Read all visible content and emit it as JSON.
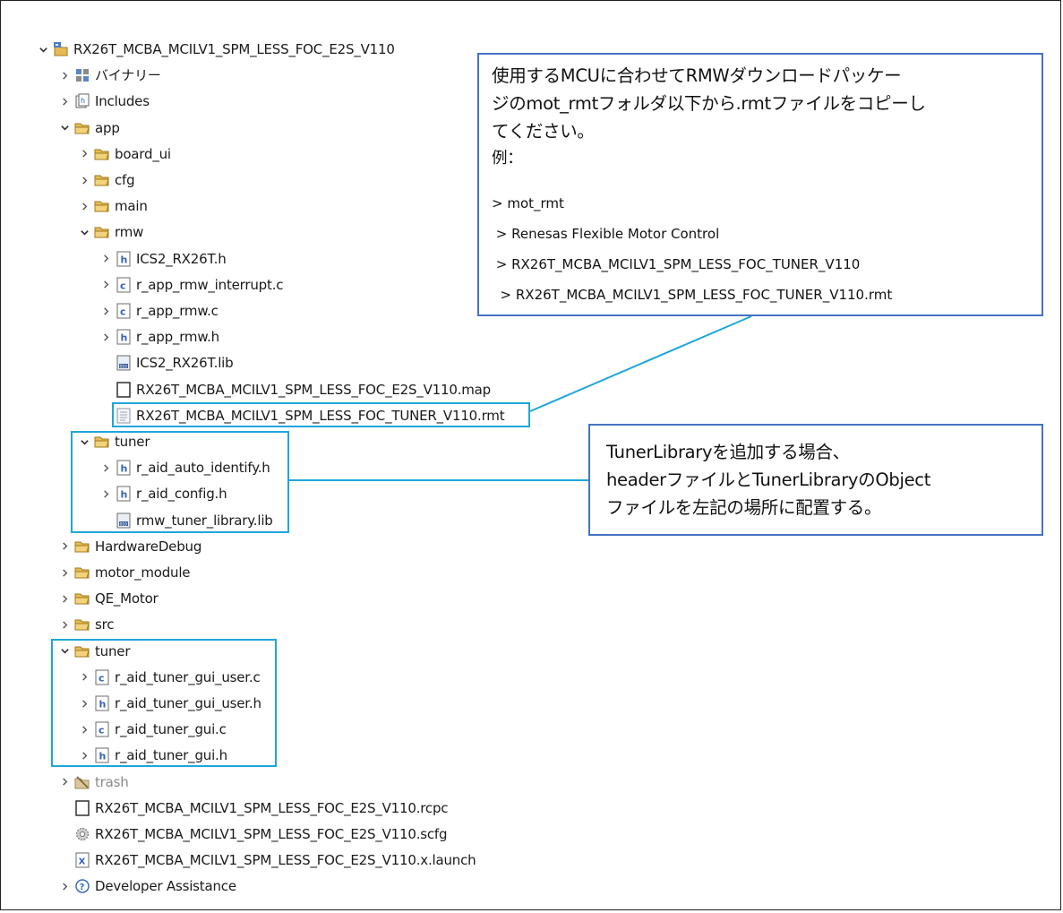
{
  "tree": [
    {
      "label": "RX26T_MCBA_MCILV1_SPM_LESS_FOC_E2S_V110",
      "icon": "project-icon",
      "expand": "expanded",
      "level": 0
    },
    {
      "label": "バイナリー",
      "icon": "binaries-icon",
      "expand": "collapsed",
      "level": 1
    },
    {
      "label": "Includes",
      "icon": "includes-icon",
      "expand": "collapsed",
      "level": 1
    },
    {
      "label": "app",
      "icon": "folder-icon",
      "expand": "expanded",
      "level": 1
    },
    {
      "label": "board_ui",
      "icon": "folder-icon",
      "expand": "collapsed",
      "level": 2
    },
    {
      "label": "cfg",
      "icon": "folder-icon",
      "expand": "collapsed",
      "level": 2
    },
    {
      "label": "main",
      "icon": "folder-icon",
      "expand": "collapsed",
      "level": 2
    },
    {
      "label": "rmw",
      "icon": "folder-icon",
      "expand": "expanded",
      "level": 2
    },
    {
      "label": "ICS2_RX26T.h",
      "icon": "header-file-icon",
      "expand": "collapsed",
      "level": 3
    },
    {
      "label": "r_app_rmw_interrupt.c",
      "icon": "c-file-icon",
      "expand": "collapsed",
      "level": 3
    },
    {
      "label": "r_app_rmw.c",
      "icon": "c-file-icon",
      "expand": "collapsed",
      "level": 3
    },
    {
      "label": "r_app_rmw.h",
      "icon": "header-file-icon",
      "expand": "collapsed",
      "level": 3
    },
    {
      "label": "ICS2_RX26T.lib",
      "icon": "lib-file-icon",
      "expand": "none",
      "level": 3
    },
    {
      "label": "RX26T_MCBA_MCILV1_SPM_LESS_FOC_E2S_V110.map",
      "icon": "blank-file-icon",
      "expand": "none",
      "level": 3
    },
    {
      "label": "RX26T_MCBA_MCILV1_SPM_LESS_FOC_TUNER_V110.rmt",
      "icon": "text-file-icon",
      "expand": "none",
      "level": 3
    },
    {
      "label": "tuner",
      "icon": "folder-icon",
      "expand": "expanded",
      "level": 2
    },
    {
      "label": "r_aid_auto_identify.h",
      "icon": "header-file-icon",
      "expand": "collapsed",
      "level": 3
    },
    {
      "label": "r_aid_config.h",
      "icon": "header-file-icon",
      "expand": "collapsed",
      "level": 3
    },
    {
      "label": "rmw_tuner_library.lib",
      "icon": "lib-file-icon",
      "expand": "none",
      "level": 3
    },
    {
      "label": "HardwareDebug",
      "icon": "folder-icon",
      "expand": "collapsed",
      "level": 1
    },
    {
      "label": "motor_module",
      "icon": "folder-icon",
      "expand": "collapsed",
      "level": 1
    },
    {
      "label": "QE_Motor",
      "icon": "folder-icon",
      "expand": "collapsed",
      "level": 1
    },
    {
      "label": "src",
      "icon": "folder-icon",
      "expand": "collapsed",
      "level": 1
    },
    {
      "label": "tuner",
      "icon": "folder-icon",
      "expand": "expanded",
      "level": 1
    },
    {
      "label": "r_aid_tuner_gui_user.c",
      "icon": "c-file-icon",
      "expand": "collapsed",
      "level": 2
    },
    {
      "label": "r_aid_tuner_gui_user.h",
      "icon": "header-file-icon",
      "expand": "collapsed",
      "level": 2
    },
    {
      "label": "r_aid_tuner_gui.c",
      "icon": "c-file-icon",
      "expand": "collapsed",
      "level": 2
    },
    {
      "label": "r_aid_tuner_gui.h",
      "icon": "header-file-icon",
      "expand": "collapsed",
      "level": 2
    },
    {
      "label": "trash",
      "icon": "trash-folder-icon",
      "expand": "collapsed",
      "level": 1,
      "muted": true
    },
    {
      "label": "RX26T_MCBA_MCILV1_SPM_LESS_FOC_E2S_V110.rcpc",
      "icon": "blank-file-icon",
      "expand": "none",
      "level": 1
    },
    {
      "label": "RX26T_MCBA_MCILV1_SPM_LESS_FOC_E2S_V110.scfg",
      "icon": "gear-file-icon",
      "expand": "none",
      "level": 1
    },
    {
      "label": "RX26T_MCBA_MCILV1_SPM_LESS_FOC_E2S_V110.x.launch",
      "icon": "launch-file-icon",
      "expand": "none",
      "level": 1
    },
    {
      "label": "Developer Assistance",
      "icon": "help-icon",
      "expand": "collapsed",
      "level": 1
    }
  ],
  "callout_rmt": {
    "line1": "使用するMCUに合わせてRMWダウンロードパッケー",
    "line2": "ジのmot_rmtフォルダ以下から.rmtファイルをコピーし",
    "line3": "てください。",
    "line4": "例：",
    "path1": "> mot_rmt",
    "path2": " > Renesas Flexible Motor Control",
    "path3": " > RX26T_MCBA_MCILV1_SPM_LESS_FOC_TUNER_V110",
    "path4": "  > RX26T_MCBA_MCILV1_SPM_LESS_FOC_TUNER_V110.rmt"
  },
  "callout_tuner": {
    "line1": "TunerLibraryを追加する場合、",
    "line2": "headerファイルとTunerLibraryのObject",
    "line3": "ファイルを左記の場所に配置する。"
  },
  "colors": {
    "highlight": "#1fa6dc",
    "callout_border": "#4472c4",
    "folder": "#e3b64a"
  }
}
